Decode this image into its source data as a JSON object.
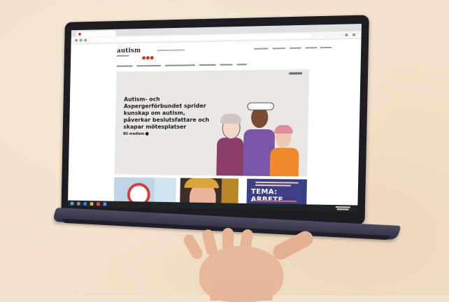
{
  "photo": {
    "wall_color": "#f3e1cb",
    "laptop_color": "#1d1d22"
  },
  "website": {
    "logo_text": "autism",
    "brand_dot_color": "#c8322c",
    "hero": {
      "headline": "Autism- och Aspergerförbundet sprider kunskap om autism, påverkar beslutsfattare och skapar mötesplatser",
      "link_label": "Bli medlem"
    },
    "cards": [
      {
        "theme": "TEMA: ARBETE"
      }
    ]
  },
  "icons": {
    "favicon": "red-circle",
    "link_arrow": "arrow-circle-icon"
  }
}
